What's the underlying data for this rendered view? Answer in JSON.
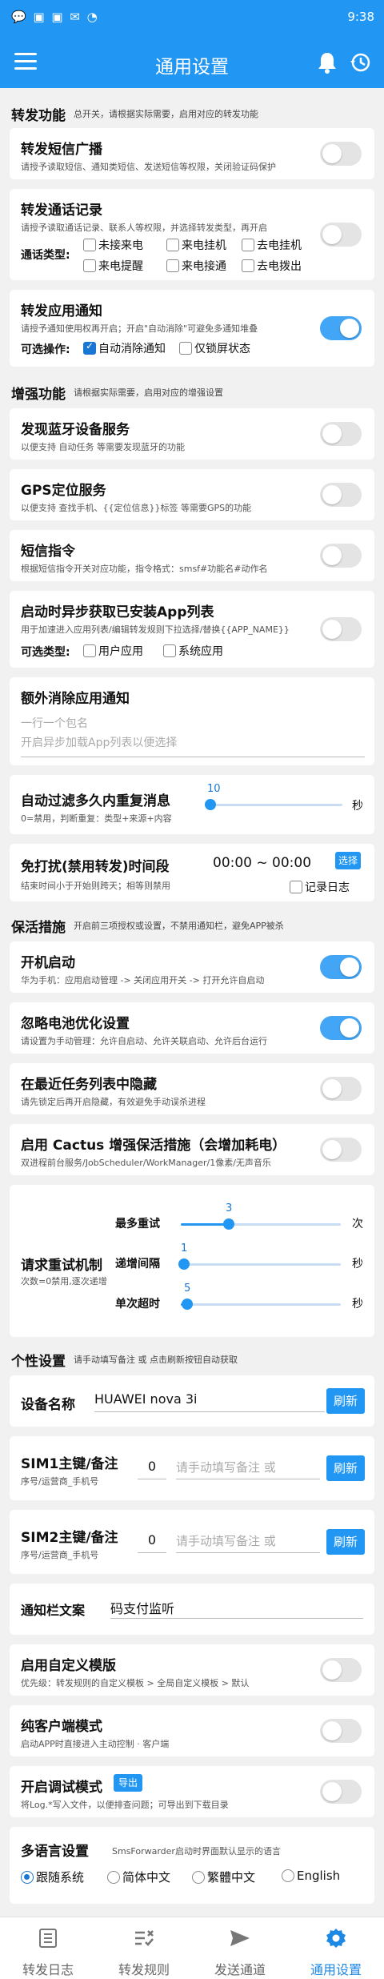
{
  "status_bar": {
    "left_icons": "💬 ▣ ▣ ✉ ◔",
    "time": "9:38"
  },
  "app_bar": {
    "title": "通用设置"
  },
  "sections": {
    "forward": {
      "title": "转发功能",
      "desc": "总开关，请根据实际需要，启用对应的转发功能"
    },
    "enhance": {
      "title": "增强功能",
      "desc": "请根据实际需要，启用对应的增强设置"
    },
    "keepalive": {
      "title": "保活措施",
      "desc": "开启前三项授权或设置，不禁用通知栏，避免APP被杀"
    },
    "personal": {
      "title": "个性设置",
      "desc": "请手动填写备注 或 点击刷新按钮自动获取"
    }
  },
  "forward_sms": {
    "title": "转发短信广播",
    "desc": "请授予读取短信、通知类短信、发送短信等权限，关闭验证码保护",
    "on": false
  },
  "forward_calls": {
    "title": "转发通话记录",
    "desc": "请授予读取通话记录、联系人等权限，并选择转发类型，再开启",
    "type_label": "通话类型:",
    "options": [
      "未接来电",
      "来电挂机",
      "去电挂机",
      "来电提醒",
      "来电接通",
      "去电拨出"
    ],
    "on": false
  },
  "forward_app": {
    "title": "转发应用通知",
    "desc": "请授予通知使用权再开启；开启\"自动消除\"可避免多通知堆叠",
    "op_label": "可选操作:",
    "options": [
      "自动消除通知",
      "仅锁屏状态"
    ],
    "on": true
  },
  "bluetooth": {
    "title": "发现蓝牙设备服务",
    "desc": "以便支持 自动任务 等需要发现蓝牙的功能",
    "on": false
  },
  "gps": {
    "title": "GPS定位服务",
    "desc": "以便支持 查找手机、{{定位信息}}标签 等需要GPS的功能",
    "on": false
  },
  "sms_cmd": {
    "title": "短信指令",
    "desc": "根据短信指令开关对应功能，指令格式：smsf#功能名#动作名",
    "on": false
  },
  "app_list": {
    "title": "启动时异步获取已安装App列表",
    "desc": "用于加速进入应用列表/编辑转发规则下拉选择/替换{{APP_NAME}}",
    "type_label": "可选类型:",
    "options": [
      "用户应用",
      "系统应用"
    ],
    "on": false
  },
  "extra_cancel": {
    "title": "额外消除应用通知",
    "placeholder": "一行一个包名\n开启异步加载App列表以便选择"
  },
  "dedupe": {
    "title": "自动过滤多久内重复消息",
    "desc": "0=禁用，判断重复：类型+来源+内容",
    "value": "10",
    "unit": "秒",
    "fraction": 0.03
  },
  "dnd": {
    "title": "免打扰(禁用转发)时间段",
    "desc": "结束时间小于开始则跨天；相等则禁用",
    "time": "00:00 ~ 00:00",
    "select_btn": "选择",
    "log_label": "记录日志"
  },
  "autostart": {
    "title": "开机启动",
    "desc": "华为手机：应用启动管理 -> 关闭应用开关 -> 打开允许自启动",
    "on": true
  },
  "battery": {
    "title": "忽略电池优化设置",
    "desc": "请设置为手动管理：允许自启动、允许关联启动、允许后台运行",
    "on": true
  },
  "hide_recents": {
    "title": "在最近任务列表中隐藏",
    "desc": "请先锁定后再开启隐藏，有效避免手动误杀进程",
    "on": false
  },
  "cactus": {
    "title": "启用 Cactus 增强保活措施（会增加耗电）",
    "desc": "双进程前台服务/JobScheduler/WorkManager/1像素/无声音乐",
    "on": false
  },
  "retry": {
    "title": "请求重试机制",
    "desc": "次数=0禁用,逐次递增",
    "rows": [
      {
        "label": "最多重试",
        "value": "3",
        "unit": "次",
        "fraction": 0.3
      },
      {
        "label": "递增间隔",
        "value": "1",
        "unit": "秒",
        "fraction": 0.02
      },
      {
        "label": "单次超时",
        "value": "5",
        "unit": "秒",
        "fraction": 0.04
      }
    ]
  },
  "device_name": {
    "label": "设备名称",
    "value": "HUAWEI nova 3i",
    "refresh": "刷新"
  },
  "sim1": {
    "label": "SIM1主键/备注",
    "sub": "序号/运营商_手机号",
    "index": "0",
    "placeholder": "请手动填写备注 或",
    "refresh": "刷新"
  },
  "sim2": {
    "label": "SIM2主键/备注",
    "sub": "序号/运营商_手机号",
    "index": "0",
    "placeholder": "请手动填写备注 或",
    "refresh": "刷新"
  },
  "notif_text": {
    "label": "通知栏文案",
    "value": "码支付监听"
  },
  "custom_template": {
    "title": "启用自定义模版",
    "desc": "优先级：转发规则的自定义模板 > 全局自定义模板 > 默认",
    "on": false
  },
  "pure_client": {
    "title": "纯客户端模式",
    "desc": "启动APP时直接进入主动控制 · 客户端",
    "on": false
  },
  "debug_mode": {
    "title": "开启调试模式",
    "export_btn": "导出",
    "desc": "将Log.*写入文件，以便排查问题；可导出到下载目录",
    "on": false
  },
  "language": {
    "title": "多语言设置",
    "desc": "SmsForwarder启动时界面默认显示的语言",
    "options": [
      "跟随系统",
      "简体中文",
      "繁體中文",
      "English"
    ],
    "selected": 0
  },
  "nav": {
    "items": [
      "转发日志",
      "转发规则",
      "发送通道",
      "通用设置"
    ],
    "active": 3,
    "active_color": "#1e88e5"
  },
  "colors": {
    "accent": "#2196f3",
    "switch_on": "#42a5f5"
  }
}
